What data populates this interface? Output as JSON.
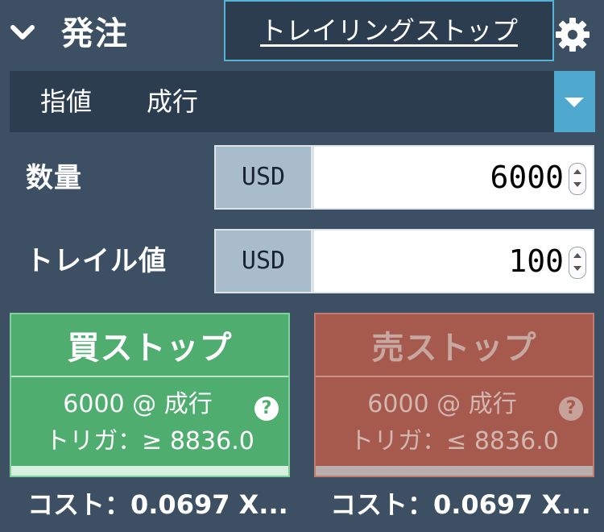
{
  "header": {
    "title": "発注",
    "icons": [
      "chevron-down-icon",
      "calculator-icon",
      "gear-icon"
    ]
  },
  "order_types": {
    "limit": "指値",
    "market": "成行",
    "trailing_stop": "トレイリングストップ"
  },
  "quantity": {
    "label": "数量",
    "currency": "USD",
    "value": "6000"
  },
  "trail": {
    "label": "トレイル値",
    "currency": "USD",
    "value": "100"
  },
  "buy": {
    "title": "買ストップ",
    "detail": "6000 @ 成行",
    "trigger": "トリガ：≥ 8836.0",
    "help": "?",
    "cost": "コスト：0.0697 X..."
  },
  "sell": {
    "title": "売ストップ",
    "detail": "6000 @ 成行",
    "trigger": "トリガ：≤ 8836.0",
    "help": "?",
    "cost": "コスト：0.0697 X..."
  },
  "colors": {
    "background": "#3c4f63",
    "buy": "#4fae6f",
    "sell": "#a65a4e",
    "accent": "#4fa8ce"
  }
}
